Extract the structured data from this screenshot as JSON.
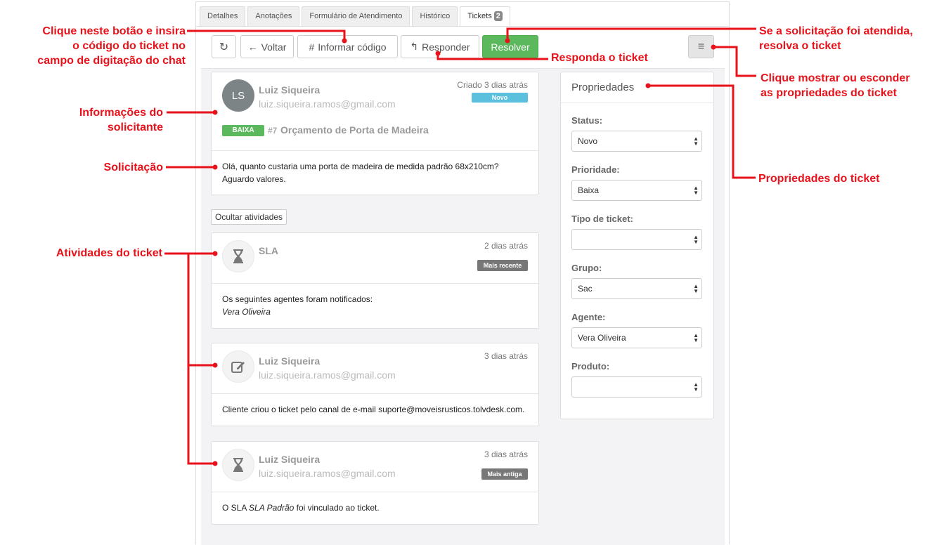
{
  "tabs": [
    {
      "label": "Detalhes"
    },
    {
      "label": "Anotações"
    },
    {
      "label": "Formulário de Atendimento"
    },
    {
      "label": "Histórico"
    },
    {
      "label": "Tickets",
      "badge": "2"
    }
  ],
  "toolbar": {
    "voltar": "Voltar",
    "informar": "Informar código",
    "responder": "Responder",
    "resolver": "Resolver"
  },
  "ticket": {
    "initials": "LS",
    "name": "Luiz Siqueira",
    "email": "luiz.siqueira.ramos@gmail.com",
    "created": "Criado 3 dias atrás",
    "status_badge": "Novo",
    "priority_badge": "BAIXA",
    "number": "#7",
    "subject": "Orçamento de Porta de Madeira",
    "message_line1": "Olá, quanto custaria uma porta de madeira de medida padrão 68x210cm?",
    "message_line2": "Aguardo valores."
  },
  "hide_activities": "Ocultar atividades",
  "activities": [
    {
      "title": "SLA",
      "time": "2 dias atrás",
      "badge": "Mais recente",
      "text1": "Os seguintes agentes foram notificados:",
      "text2": "Vera Oliveira"
    },
    {
      "title": "Luiz Siqueira",
      "email": "luiz.siqueira.ramos@gmail.com",
      "time": "3 dias atrás",
      "text1": "Cliente criou o ticket pelo canal de e-mail suporte@moveisrusticos.tolvdesk.com."
    },
    {
      "title": "Luiz Siqueira",
      "email": "luiz.siqueira.ramos@gmail.com",
      "time": "3 dias atrás",
      "badge": "Mais antiga",
      "text_pre": "O SLA ",
      "text_em": "SLA Padrão",
      "text_post": " foi vinculado ao ticket."
    }
  ],
  "properties": {
    "title": "Propriedades",
    "fields": [
      {
        "label": "Status:",
        "value": "Novo"
      },
      {
        "label": "Prioridade:",
        "value": "Baixa"
      },
      {
        "label": "Tipo de ticket:",
        "value": ""
      },
      {
        "label": "Grupo:",
        "value": "Sac"
      },
      {
        "label": "Agente:",
        "value": "Vera Oliveira"
      },
      {
        "label": "Produto:",
        "value": ""
      }
    ]
  },
  "annotations": {
    "codigo": [
      "Clique neste botão e insira",
      "o código do ticket no",
      "campo de digitação do chat"
    ],
    "solicitante": [
      "Informações do",
      "solicitante"
    ],
    "solicitacao": "Solicitação",
    "atividades": "Atividades do ticket",
    "resolver": [
      "Se a solicitação foi atendida,",
      "resolva o ticket"
    ],
    "responder": "Responda o ticket",
    "mostrar": [
      "Clique mostrar ou esconder",
      "as propriedades do ticket"
    ],
    "propriedades": "Propriedades do ticket"
  },
  "colors": {
    "accent_red": "#e8121b",
    "resolver_green": "#5cb85c",
    "novo_blue": "#5bc0de",
    "baixa_green": "#5cb85c",
    "badge_gray": "#777777"
  }
}
